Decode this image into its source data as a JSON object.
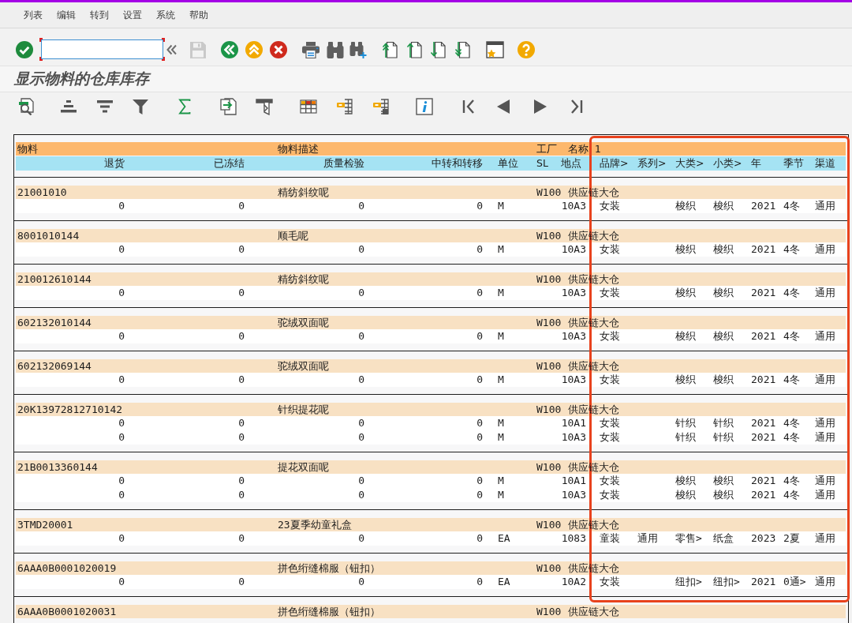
{
  "menu_bar": [
    "列表",
    "编辑",
    "转到",
    "设置",
    "系统",
    "帮助"
  ],
  "toolbar": {
    "save_button": {
      "disabled": true
    }
  },
  "title": "显示物料的仓库库存",
  "list": {
    "header": {
      "material": "物料",
      "description": "物料描述",
      "plant": "工厂",
      "plant_name": "名称 1"
    },
    "columns": [
      "退货",
      "已冻结",
      "质量检验",
      "中转和转移",
      "单位",
      "SL",
      "地点",
      "品牌>",
      "系列>",
      "大类>",
      "小类>",
      "年",
      "季节",
      "渠道"
    ],
    "groups": [
      {
        "material": "21001010",
        "description": "精纺斜纹呢",
        "plant": "W100",
        "plant_name": "供应链大仓",
        "rows": [
          {
            "returns": "0",
            "blocked": "0",
            "quality_inspection": "0",
            "in_transit": "0",
            "unit": "M",
            "location": "10A3",
            "brand": "女装",
            "category": "梭织",
            "subcategory": "梭织",
            "year": "2021",
            "season": "4冬",
            "channel": "通用"
          }
        ]
      },
      {
        "material": "8001010144",
        "description": "顺毛呢",
        "plant": "W100",
        "plant_name": "供应链大仓",
        "rows": [
          {
            "returns": "0",
            "blocked": "0",
            "quality_inspection": "0",
            "in_transit": "0",
            "unit": "M",
            "location": "10A3",
            "brand": "女装",
            "category": "梭织",
            "subcategory": "梭织",
            "year": "2021",
            "season": "4冬",
            "channel": "通用"
          }
        ]
      },
      {
        "material": "210012610144",
        "description": "精纺斜纹呢",
        "plant": "W100",
        "plant_name": "供应链大仓",
        "rows": [
          {
            "returns": "0",
            "blocked": "0",
            "quality_inspection": "0",
            "in_transit": "0",
            "unit": "M",
            "location": "10A3",
            "brand": "女装",
            "category": "梭织",
            "subcategory": "梭织",
            "year": "2021",
            "season": "4冬",
            "channel": "通用"
          }
        ]
      },
      {
        "material": "602132010144",
        "description": "驼绒双面呢",
        "plant": "W100",
        "plant_name": "供应链大仓",
        "rows": [
          {
            "returns": "0",
            "blocked": "0",
            "quality_inspection": "0",
            "in_transit": "0",
            "unit": "M",
            "location": "10A3",
            "brand": "女装",
            "category": "梭织",
            "subcategory": "梭织",
            "year": "2021",
            "season": "4冬",
            "channel": "通用"
          }
        ]
      },
      {
        "material": "602132069144",
        "description": "驼绒双面呢",
        "plant": "W100",
        "plant_name": "供应链大仓",
        "rows": [
          {
            "returns": "0",
            "blocked": "0",
            "quality_inspection": "0",
            "in_transit": "0",
            "unit": "M",
            "location": "10A3",
            "brand": "女装",
            "category": "梭织",
            "subcategory": "梭织",
            "year": "2021",
            "season": "4冬",
            "channel": "通用"
          }
        ]
      },
      {
        "material": "20K13972812710142",
        "description": "针织提花呢",
        "plant": "W100",
        "plant_name": "供应链大仓",
        "rows": [
          {
            "returns": "0",
            "blocked": "0",
            "quality_inspection": "0",
            "in_transit": "0",
            "unit": "M",
            "location": "10A1",
            "brand": "女装",
            "category": "针织",
            "subcategory": "针织",
            "year": "2021",
            "season": "4冬",
            "channel": "通用"
          },
          {
            "returns": "0",
            "blocked": "0",
            "quality_inspection": "0",
            "in_transit": "0",
            "unit": "M",
            "location": "10A3",
            "brand": "女装",
            "category": "针织",
            "subcategory": "针织",
            "year": "2021",
            "season": "4冬",
            "channel": "通用"
          }
        ]
      },
      {
        "material": "21B0013360144",
        "description": "提花双面呢",
        "plant": "W100",
        "plant_name": "供应链大仓",
        "rows": [
          {
            "returns": "0",
            "blocked": "0",
            "quality_inspection": "0",
            "in_transit": "0",
            "unit": "M",
            "location": "10A1",
            "brand": "女装",
            "category": "梭织",
            "subcategory": "梭织",
            "year": "2021",
            "season": "4冬",
            "channel": "通用"
          },
          {
            "returns": "0",
            "blocked": "0",
            "quality_inspection": "0",
            "in_transit": "0",
            "unit": "M",
            "location": "10A3",
            "brand": "女装",
            "category": "梭织",
            "subcategory": "梭织",
            "year": "2021",
            "season": "4冬",
            "channel": "通用"
          }
        ]
      },
      {
        "material": "3TMD20001",
        "description": "23夏季幼童礼盒",
        "plant": "W100",
        "plant_name": "供应链大仓",
        "rows": [
          {
            "returns": "0",
            "blocked": "0",
            "quality_inspection": "0",
            "in_transit": "0",
            "unit": "EA",
            "location": "1083",
            "brand": "童装",
            "series": "通用",
            "category": "零售>",
            "subcategory": "纸盒",
            "year": "2023",
            "season": "2夏",
            "channel": "通用"
          }
        ]
      },
      {
        "material": "6AAA0B0001020019",
        "description": "拼色绗缝棉服（钮扣）",
        "plant": "W100",
        "plant_name": "供应链大仓",
        "rows": [
          {
            "returns": "0",
            "blocked": "0",
            "quality_inspection": "0",
            "in_transit": "0",
            "unit": "EA",
            "location": "10A2",
            "brand": "女装",
            "category": "纽扣>",
            "subcategory": "纽扣>",
            "year": "2021",
            "season": "0通>",
            "channel": "通用"
          }
        ]
      },
      {
        "material": "6AAA0B0001020031",
        "description": "拼色绗缝棉服（钮扣）",
        "plant": "W100",
        "plant_name": "供应链大仓"
      }
    ]
  }
}
